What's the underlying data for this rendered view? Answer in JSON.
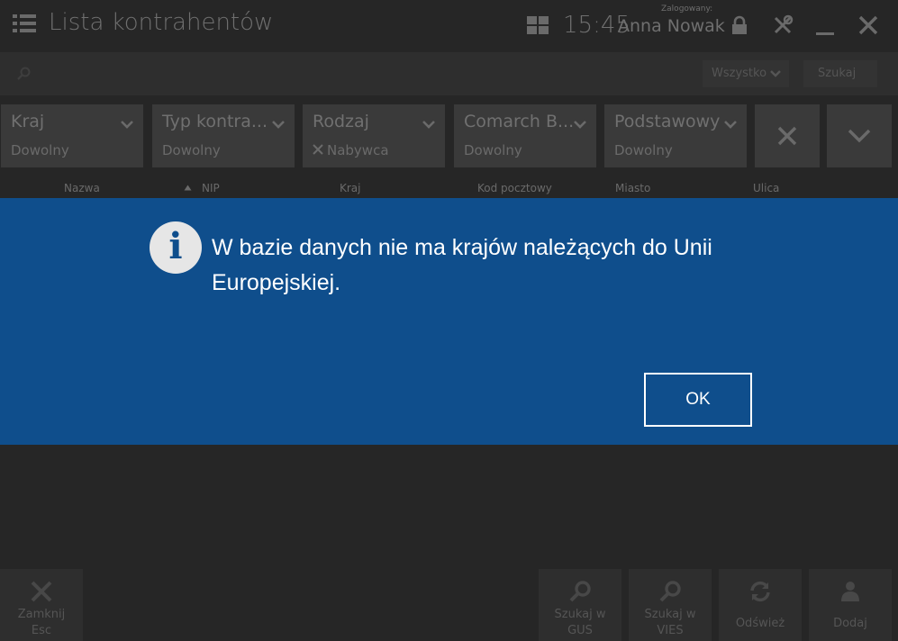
{
  "header": {
    "title": "Lista kontrahentów",
    "time": "15:45",
    "logged_label": "Zalogowany:",
    "user": "Anna Nowak"
  },
  "search": {
    "placeholder": "",
    "scope": "Wszystko",
    "button": "Szukaj"
  },
  "filters": [
    {
      "label": "Kraj",
      "value": "Dowolny",
      "cleared": false
    },
    {
      "label": "Typ kontra...",
      "value": "Dowolny",
      "cleared": false
    },
    {
      "label": "Rodzaj",
      "value": "Nabywca",
      "cleared": true
    },
    {
      "label": "Comarch B...",
      "value": "Dowolny",
      "cleared": false
    },
    {
      "label": "Podstawowy",
      "value": "Dowolny",
      "cleared": false
    }
  ],
  "columns": [
    "Nazwa",
    "NIP",
    "Kraj",
    "Kod pocztowy",
    "Miasto",
    "Ulica"
  ],
  "dialog": {
    "message": "W bazie danych nie ma krajów należących do Unii Europejskiej.",
    "ok": "OK"
  },
  "footer": {
    "close": "Zamknij\nEsc",
    "gus": "Szukaj w\nGUS",
    "vies": "Szukaj w\nVIES",
    "refresh": "Odśwież",
    "add": "Dodaj"
  },
  "colors": {
    "dialog_bg": "#0f4e8c",
    "background": "#262626",
    "tile": "#3a3a3a"
  }
}
